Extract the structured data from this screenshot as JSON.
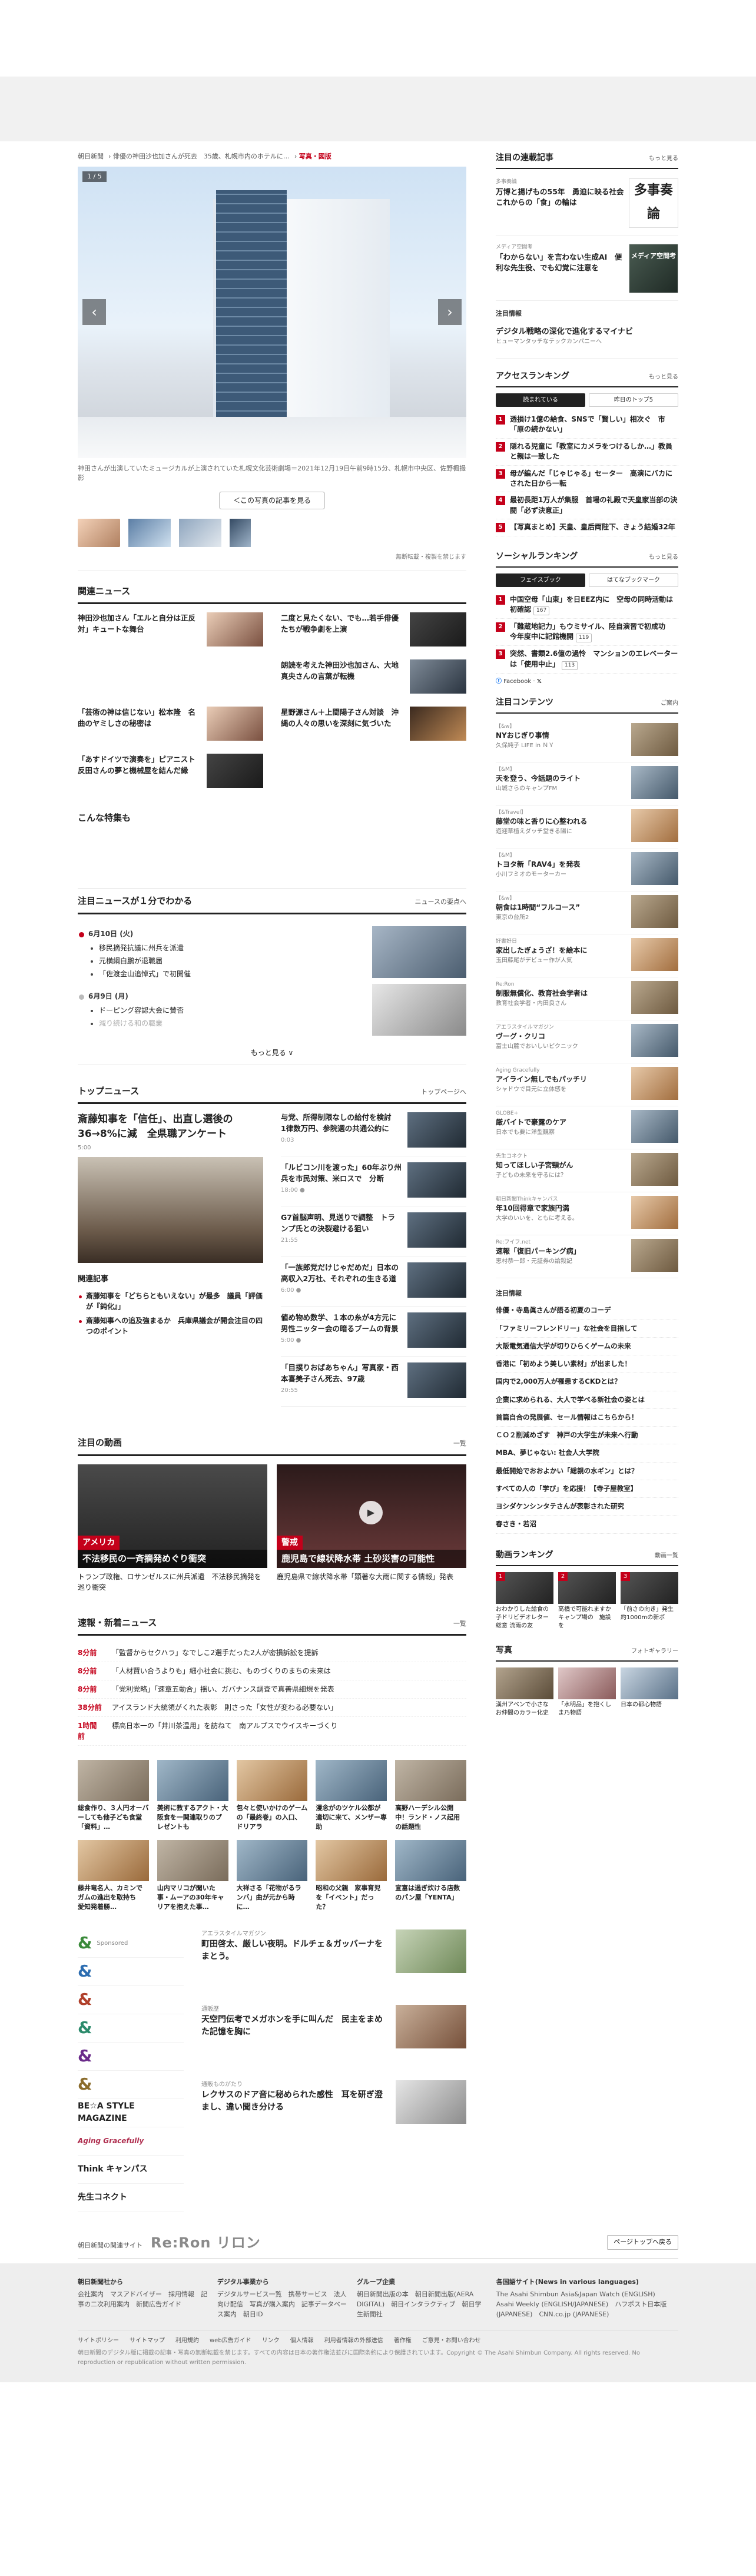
{
  "crumbs": [
    "朝日新聞",
    "俳優の神田沙也加さんが死去　35歳、札幌市内のホテルに…",
    "写真・図版"
  ],
  "hero": {
    "counter": "1 / 5",
    "caption": "神田さんが出演していたミュージカルが上演されていた札幌文化芸術劇場＝2021年12月19日午前9時15分、札幌市中央区、佐野楓撮影",
    "back_button": "＜この写真の記事を見る",
    "usage": "無断転載・複製を禁じます"
  },
  "related": {
    "title": "関連ニュース",
    "items": [
      "神田沙也加さん「エルと自分は正反対」キュートな舞台",
      "二度と見たくない、でも…若手俳優たちが戦争劇を上演",
      "",
      "朗読を考えた神田沙也加さん、大地真央さんの言葉が転機",
      "「芸術の神は信じない」松本隆　名曲のヤミしさの秘密は",
      "星野源さん＋上間陽子さん対談　沖縄の人々の思いを深刻に気づいた",
      "「あすドイツで演奏を」ピアニスト反田さんの夢と機械屋を結んだ縁"
    ]
  },
  "feature": {
    "title": "こんな特集も"
  },
  "minute": {
    "title": "注目ニュースが１分でわかる",
    "more": "ニュースの要点へ",
    "day1": "6月10日 (火)",
    "day1_items": [
      "移民摘発抗議に州兵を派遣",
      "元横綱白鵬が退職届",
      "「佐渡金山追悼式」で初開催"
    ],
    "day2": "6月9日 (月)",
    "day2_items": [
      "ドーピング容認大会に賛否",
      "減り続ける和の職業"
    ],
    "see_more": "もっと見る ∨"
  },
  "topnews": {
    "title": "トップニュース",
    "more": "トップページへ",
    "lead": "斎藤知事を「信任」、出直し選後の36→8%に減　全県職アンケート",
    "lead_time": "5:00",
    "related_title": "関連記事",
    "related_items": [
      "斎藤知事を「どちらともいえない」が最多　議員「評価が『鈍化』」",
      "斎藤知事への追及強まるか　兵庫県議会が開会注目の四つのポイント"
    ],
    "items": [
      {
        "text": "与党、所得制限なしの給付を検討　1律数万円、参院選の共通公約に",
        "time": "0:03"
      },
      {
        "text": "「ルビコン川を渡った」60年ぶり州兵を市民対策、米ロスで　分断",
        "time": "18:00 ●"
      },
      {
        "text": "G7首脳声明、見送りで調整　トランプ氏との決裂避ける狙い",
        "time": "21:55 "
      },
      {
        "text": "「一族郎党だけじゃだめだ」日本の高収入2万社、それぞれの生きる道",
        "time": "6:00 ●"
      },
      {
        "text": "値め物め数学、１本の糸が4方元に　男性ニッター会の暗るブームの背景",
        "time": "5:00 ●"
      },
      {
        "text": "「目撲りおばあちゃん」写真家・西本喜美子さん死去、97歳",
        "time": "20:55"
      }
    ]
  },
  "videos": {
    "title": "注目の動画",
    "more": "一覧",
    "items": [
      {
        "tag": "アメリカ",
        "title": "不法移民の一斉摘発めぐり衝突",
        "caption": "トランプ政権、ロサンゼルスに州兵派遣　不法移民摘発を巡り衝突"
      },
      {
        "tag": "警戒",
        "title": "鹿児島で線状降水帯 土砂災害の可能性",
        "caption": "鹿児島県で線状降水帯「顕著な大雨に関する情報」発表"
      }
    ]
  },
  "speed": {
    "title": "速報・新着ニュース",
    "more": "一覧",
    "items": [
      {
        "t": "8分前",
        "text": "「監督からセクハラ」なでしこ2選手だった2人が密損訴訟を提訴"
      },
      {
        "t": "8分前",
        "text": "「人材賢い合うよりも」細小社会に挑む、ものづくりのまちの未来は"
      },
      {
        "t": "8分前",
        "text": "「党利党略」「速章五動合」揺い、ガバナンス調査で真善県細規を発表"
      },
      {
        "t": "38分前",
        "text": "アイスランド大統領がくれた表彰　則さった「女性が変わる必要ない」"
      },
      {
        "t": "1時間前",
        "text": "標高日本一の「井川茶温用」を訪ねて　南アルプスでウイスキーづくり"
      }
    ]
  },
  "cards": [
    "総食作り、３人円オーバーしても他子ども食堂「資料」…",
    "美術に教するアクト・大阪食を一関連取りのプレゼントも",
    "包々と使いかけのゲームの「最終巻」の入口、ドリアラ",
    "漫念がのツケル公都が適切に来て、メンザー専助",
    "高野ハーデシル公開中！ランド・ノス起用の話題性",
    "藤井竜名人、カミンでガムの進出を取持ち　愛知発着勝…",
    "山内マリコが聞いた事・ムーアの30年キャリアを抱えた事…",
    "大祥さる「花物がるランバ」曲が元から時に…",
    "昭和の父親　家事育児を「イベント」だった？",
    "宣富は過ぎ炊ける店数のパン屋「YENTA」"
  ],
  "brands": [
    "アエラスタイルマガジン",
    "&",
    "&",
    "&",
    "&",
    "&",
    "&",
    "BE☆A STYLE MAGAZINE",
    "Aging Gracefully",
    "Think キャンパス",
    "先生コネクト"
  ],
  "mags": [
    {
      "label": "アエラスタイルマガジン",
      "text": "町田啓太、厳しい夜明。ドルチェ＆ガッバーナをまとう。"
    },
    {
      "label": "通販歴",
      "text": "天空門伝考でメガホンを手に叫んだ　民主をまめた記憶を胸に"
    },
    {
      "label": "通販ものがたり",
      "text": "レクサスのドア音に秘められた感性　耳を研ぎ澄まし、違い聞き分ける"
    }
  ],
  "side": {
    "serial_title": "注目の連載記事",
    "serial_more": "もっと見る",
    "serial_items": [
      {
        "label": "多事奏論",
        "text": "万博と揚げもの55年　勇迫に映る社会　これからの「食」の輪は",
        "ph": "多事奏論"
      },
      {
        "label": "メディア空間考",
        "text": "「わからない」を言わない生成AI　便利な先生役、でも幻覚に注意を",
        "ph": "メディア空間考"
      }
    ],
    "notice_label": "注目情報",
    "ad_title": "デジタル戦略の深化で進化するマイナビ",
    "ad_sub": "ヒューマンタッチなテックカンパニーへ",
    "access_title": "アクセスランキング",
    "access_more": "もっと見る",
    "access_tabs": [
      "読まれている",
      "昨日のトップ5"
    ],
    "access_items": [
      {
        "n": "1",
        "text": "透損け1億の給食、SNSで「賢しい」相次ぐ　市「原の続かない」"
      },
      {
        "n": "2",
        "text": "隠れる児童に「教室にカメラをつけるしか…」教員と親は一致した"
      },
      {
        "n": "3",
        "text": "母が編んだ「じゃじゃる」セーター　高演にバカにされた日から一転"
      },
      {
        "n": "4",
        "text": "最初長距1万人が集服　首場の礼殿で天皇家当部の決闘「必ず決意正」"
      },
      {
        "n": "5",
        "text": "【写真まとめ】天皇、皇后両陛下、きょう結婚32年"
      }
    ],
    "social_title": "ソーシャルランキング",
    "social_more": "もっと見る",
    "social_tabs": [
      "フェイスブック",
      "はてなブックマーク"
    ],
    "social_items": [
      {
        "n": "1",
        "text": "中国空母「山東」を日EEZ内に　空母の同時活動は初確認",
        "cnt": "167"
      },
      {
        "n": "2",
        "text": "「難蔵地記力」もウミサイル、陸自演習で初成功　今年度中に記館機開",
        "cnt": "119"
      },
      {
        "n": "3",
        "text": "突然、書類2.6億の過怜　マンションのエレベーターは「使用中止」",
        "cnt": "113"
      }
    ],
    "share_text": "Facebook",
    "contents_title": "注目コンテンツ",
    "contents_more": "ご案内",
    "contents": [
      {
        "label": "【&w】",
        "text": "NYおじぎり事情",
        "sub": "久保純子 LIFE in ＮＹ"
      },
      {
        "label": "【&M】",
        "text": "天を登う、今話題のライト",
        "sub": "山城さらのキャンプFM"
      },
      {
        "label": "【&Travel】",
        "text": "藤堂の味と香りに心整われる",
        "sub": "遊迎草植えダッチ堂きる陽に"
      },
      {
        "label": "【&M】",
        "text": "トヨタ新「RAV4」を発表",
        "sub": "小川フミオのモーターカー"
      },
      {
        "label": "【&w】",
        "text": "朝食は1時間“フルコース”",
        "sub": "東京の台所2"
      },
      {
        "label": "好書好日",
        "text": "家出したぎょうざ！を絵本に",
        "sub": "玉田藤尾がデビュー作が人気"
      },
      {
        "label": "Re:Ron",
        "text": "制服無償化、教育社会学者は",
        "sub": "教育社会学者・内田良さん"
      },
      {
        "label": "アエラスタイルマガジン",
        "text": "ヴーグ・クリコ",
        "sub": "富士山麓でおいしいピクニック"
      },
      {
        "label": "Aging Gracefully",
        "text": "アイライン無しでもパッチリ",
        "sub": "シャドウで目元に立体感を"
      },
      {
        "label": "GLOBE+",
        "text": "厳バイトで豪露のケア",
        "sub": "日本でも要に洋型観察"
      },
      {
        "label": "先生コネクト",
        "text": "知ってほしい子宮頸がん",
        "sub": "子どもの未来を守るには？"
      },
      {
        "label": "朝日新聞Thinkキャンパス",
        "text": "年10回得章で家族円満",
        "sub": "大学のいいを、ともに考える。"
      },
      {
        "label": "Re:フイフ.net",
        "text": "速報「復旧パーキング病」",
        "sub": "恵村恭一郎・元証券の論殺記"
      }
    ],
    "info_title": "注目情報",
    "info_items": [
      "俳優・寺島眞さんが語る初夏のコーデ",
      "「ファミリーフレンドリー」な社会を目指して",
      "大阪電気通信大学が切りひらくゲームの未来",
      "香港に「初めよう美しい素材」が出ました！",
      "国内で2,000万人が罹患するCKDとは？",
      "企業に求められる、大人で学べる新社会の姿とは",
      "首篇自合の発展値、セール情報はこちらから！",
      "ＣＯ２削減めざす　神戸の大学生が未来へ行動",
      "MBA、夢じゃない: 社会人大学院",
      "最低開始でおおよかい「総親の水ギン」とは？",
      "すべての人の「学び」を応援！【寺子屋教室】",
      "ヨシダケンシンタテさんが表彰された研究",
      "春さき・若沼"
    ],
    "video_rank_title": "動画ランキング",
    "video_rank_more": "動画一覧",
    "video_rank": [
      "おわかりした給食の子ドリビデオレター総意 流雨の友　",
      "高橋で可能れますかキャンプ場の　施設を　",
      "「前さの向き」発生約1000mの新ポ"
    ],
    "photo_title": "写真",
    "photo_more": "フォトギャラリー",
    "photos": [
      "漢州アベンで小さなお仲間のカラー化史",
      "「水明品」を抱くしま乃物語",
      "日本の都心物語"
    ]
  },
  "pagetop": "ページトップへ戻る",
  "footer": {
    "site_label": "朝日新聞の関連サイト",
    "site_brand": "Re:Ron リロン",
    "cols": [
      {
        "h": "朝日新聞社から",
        "p": "会社案内　マスアドバイザー　採用情報　記事の二次利用案内　新聞広告ガイド"
      },
      {
        "h": "デジタル事業から",
        "p": "デジタルサービス一覧　携帯サービス　法人向け配信　写真が購入案内　記事データベース案内　朝日ID"
      },
      {
        "h": "グループ企業",
        "p": "朝日新聞出版の本　朝日新聞出版(AERA DIGITAL)　朝日インタラクティブ　朝日学生新聞社"
      },
      {
        "h": "各国語サイト(News in various languages)",
        "p": "The Asahi Shimbun Asia&Japan Watch (ENGLISH)　Asahi Weekly (ENGLISH/JAPANESE)　ハフポスト日本版 (JAPANESE)　CNN.co.jp (JAPANESE)"
      }
    ],
    "links": [
      "サイトポリシー",
      "サイトマップ",
      "利用規約",
      "web広告ガイド",
      "リンク",
      "個人情報",
      "利用者情報の外部送信",
      "著作権",
      "ご意見・お問い合わせ"
    ],
    "copy": "朝日新聞のデジタル版に掲載の記事・写真の無断転載を禁じます。すべての内容は日本の著作権法並びに国際条約により保護されています。Copyright © The Asahi Shimbun Company. All rights reserved. No reproduction or republication without written permission."
  }
}
